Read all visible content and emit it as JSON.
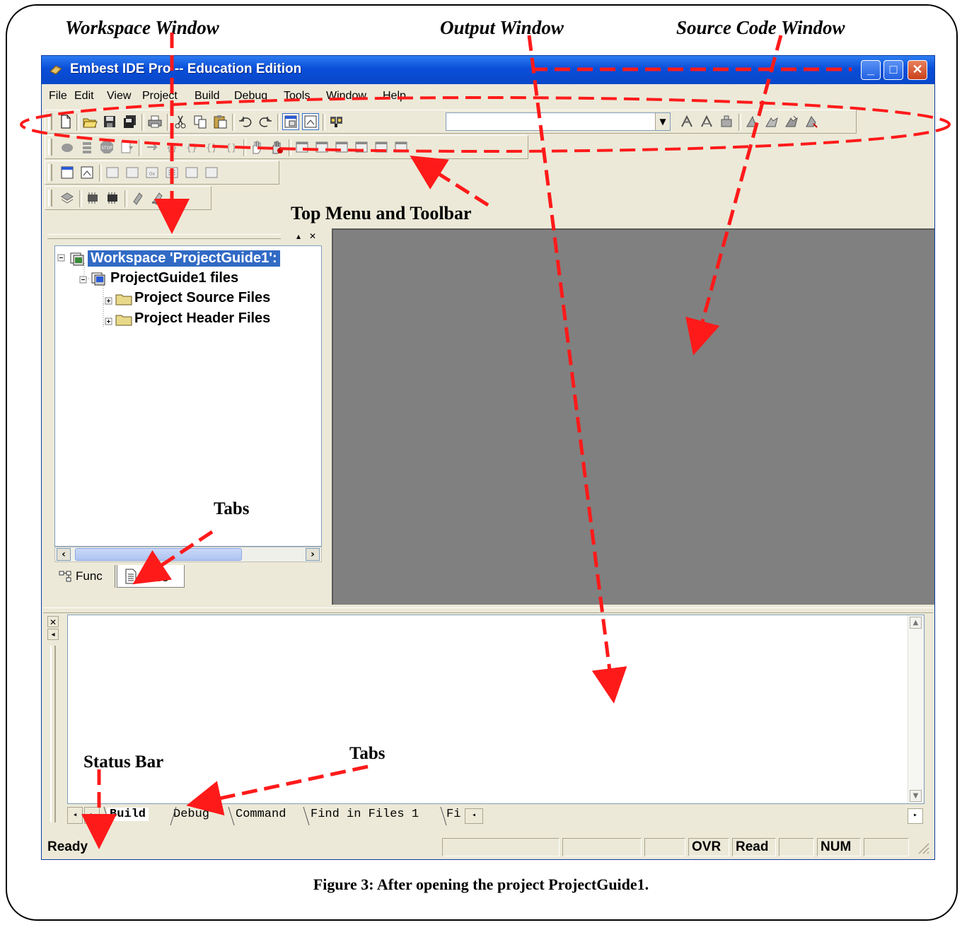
{
  "callouts": {
    "workspace_window": "Workspace Window",
    "output_window": "Output Window",
    "source_code_window": "Source Code Window",
    "top_menu_toolbar": "Top Menu and Toolbar",
    "tabs_workspace": "Tabs",
    "tabs_output": "Tabs",
    "status_bar": "Status Bar"
  },
  "window": {
    "title": "Embest IDE Pro -- Education Edition",
    "min_glyph": "_",
    "max_glyph": "□",
    "close_glyph": "✕"
  },
  "menu": [
    "File",
    "Edit",
    "View",
    "Project",
    "Build",
    "Debug",
    "Tools",
    "Window",
    "Help"
  ],
  "workspace": {
    "header_buttons": [
      "▴",
      "✕"
    ],
    "tree": {
      "root": "Workspace 'ProjectGuide1':",
      "project": "ProjectGuide1 files",
      "folders": [
        "Project Source Files",
        "Project Header Files"
      ]
    },
    "tabs": [
      "Func",
      "Files"
    ],
    "active_tab": "Files"
  },
  "output": {
    "tabs": [
      "Build",
      "Debug",
      "Command",
      "Find in Files 1",
      "Fi"
    ],
    "active_tab": "Build"
  },
  "status": {
    "ready": "Ready",
    "ovr": "OVR",
    "read": "Read",
    "num": "NUM"
  },
  "caption": "Figure 3: After opening the project ProjectGuide1.",
  "colors": {
    "annotation_red": "#ff1a1a",
    "titlebar_blue": "#0a4ed9",
    "xp_face": "#ece9d8",
    "editor_gray": "#808080",
    "selection_blue": "#316ac5"
  }
}
